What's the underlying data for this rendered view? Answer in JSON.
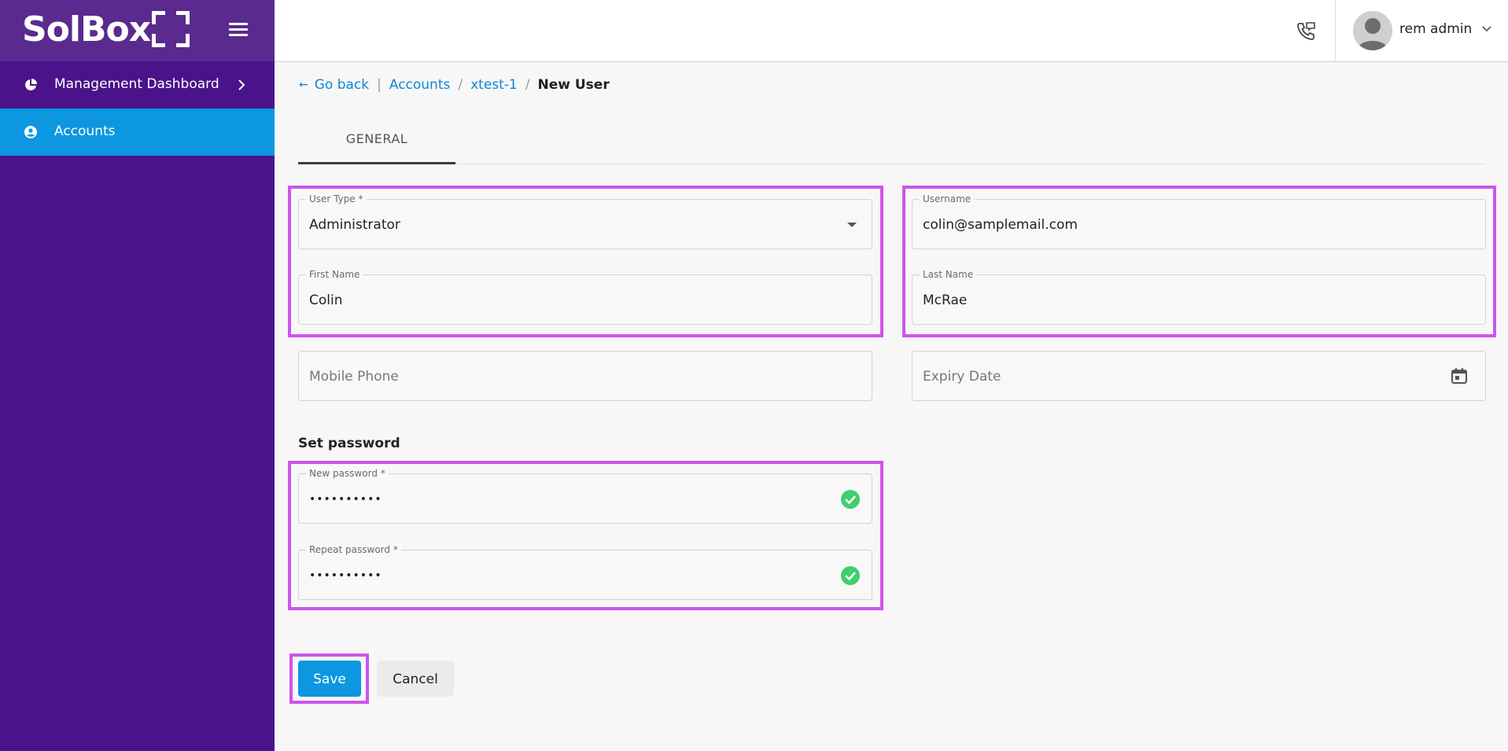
{
  "brand": {
    "name": "SolBox"
  },
  "sidebar": {
    "items": [
      {
        "label": "Management Dashboard",
        "icon": "pie-chart-icon",
        "active": false
      },
      {
        "label": "Accounts",
        "icon": "account-circle-icon",
        "active": true
      }
    ]
  },
  "header": {
    "user_name": "rem admin"
  },
  "breadcrumb": {
    "back": "Go back",
    "items": [
      "Accounts",
      "xtest-1"
    ],
    "current": "New User"
  },
  "tabs": [
    {
      "label": "GENERAL",
      "active": true
    }
  ],
  "form": {
    "user_type": {
      "label": "User Type *",
      "value": "Administrator"
    },
    "username": {
      "label": "Username",
      "value": "colin@samplemail.com"
    },
    "first_name": {
      "label": "First Name",
      "value": "Colin"
    },
    "last_name": {
      "label": "Last Name",
      "value": "McRae"
    },
    "mobile_phone": {
      "placeholder": "Mobile Phone"
    },
    "expiry_date": {
      "placeholder": "Expiry Date"
    },
    "password_section": "Set password",
    "new_password": {
      "label": "New password *",
      "value": "••••••••••"
    },
    "repeat_password": {
      "label": "Repeat password *",
      "value": "••••••••••"
    }
  },
  "actions": {
    "save": "Save",
    "cancel": "Cancel"
  },
  "colors": {
    "sidebar": "#4a138a",
    "active_nav": "#0c97e0",
    "link": "#0c87d8",
    "highlight": "#cc55ee",
    "valid": "#3fcf6b"
  }
}
